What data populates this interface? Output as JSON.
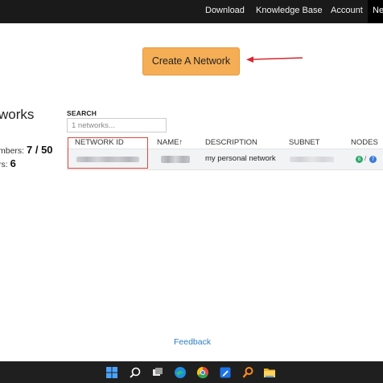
{
  "nav": {
    "download": "Download",
    "knowledge_base": "Knowledge Base",
    "account": "Account",
    "networks": "Networks"
  },
  "create_button": "Create A Network",
  "left": {
    "title": "works",
    "members_label": "mbers:",
    "members_value": "7 / 50",
    "networks_label": "rs:",
    "networks_value": "6"
  },
  "search": {
    "label": "SEARCH",
    "placeholder": "1 networks..."
  },
  "table": {
    "headers": [
      "NETWORK ID",
      "NAME↑",
      "DESCRIPTION",
      "SUBNET",
      "NODES"
    ],
    "row": {
      "description": "my personal network",
      "nodes_online": "6",
      "nodes_separator": "/",
      "nodes_total": "7"
    }
  },
  "feedback": "Feedback",
  "colors": {
    "accent": "#f5ae55",
    "highlight": "#e0473d",
    "link": "#2d7cc1",
    "nodes_online": "#2da86a",
    "nodes_total": "#3a7bd5"
  },
  "taskbar_icons": [
    "windows-start-icon",
    "search-icon",
    "task-view-icon",
    "edge-browser-icon",
    "chrome-icon",
    "notes-app-icon",
    "search-tool-icon",
    "file-explorer-icon"
  ]
}
